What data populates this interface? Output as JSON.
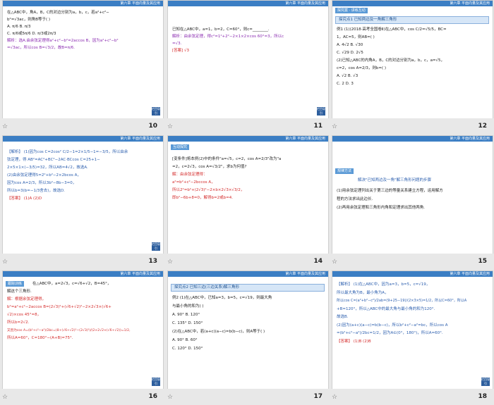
{
  "header_tag": "第六章  平面向量及其应用",
  "nav_label": "栏目导引",
  "star": "☆",
  "slides": [
    {
      "number": "10",
      "lines": [
        "在△ABC中，角A，B，C的对边分别为a，b，c，若a²+c²−",
        "b²=√3ac，则角B等于(      )",
        "A. π/6                       B. π/3",
        "C. π/6或5π/6              D. π/3或2π/3",
        "解析：选A.由余弦定理得a²+c²−b²=2accos B，因为a²+c²−b²",
        "=√3ac，所以cos B=√3/2，故B=π/6."
      ]
    },
    {
      "number": "11",
      "lines": [
        "已知在△ABC中，a=1，b=2，C=60°，则c=________.",
        "解析：由余弦定理，得c²=1²+2²−2×1×2×cos 60°=3，所以c",
        "=√3.",
        "[答案] √3"
      ]
    },
    {
      "number": "12",
      "tag": "探究案 · 讲练互动",
      "section": "探究点1  已知两边及一角解三角形",
      "lines": [
        "例1  (1)(2018·高考全国卷Ⅱ)在△ABC中，cos C/2=√5/5，BC=",
        "1，AC=5，则AB=(      )",
        "A. 4√2                      B. √30",
        "C. √29                      D. 2√5",
        "(2)已知△ABC的内角A，B，C的对边分别为a，b，c，a=√5，",
        "c=2，cos A=2/3，则b=(      )",
        "A. √2                        B. √3",
        "C. 2                          D. 3"
      ]
    },
    {
      "number": "13",
      "lines": [
        "【解析】 (1)因为cos C=2cos² C/2−1=2×1/5−1=−3/5，所以由余",
        "弦定理，得 AB²=AC²+BC²−2AC·BCcos C=25+1−",
        "2×5×1×(−3/5)=32，所以AB=4√2，故选A.",
        "(2)由余弦定理得5=2²+b²−2×2bcos A，",
        "因为cos A=2/3，所以3b²−8b−3=0，",
        "所以b=3(b=−1/3舍去)，故选D.",
        "【答案】 (1)A  (2)D"
      ]
    },
    {
      "number": "14",
      "tag": "互动探究",
      "lines": [
        "[变条件]将本例(2)中的条件\"a=√5，c=2，cos A=2/3\"改为\"a",
        "=2，c=2√3，cos A=√3/2\"，求b为何值?",
        "解：由余弦定理得：",
        "a²=b²+c²−2bccos A，",
        "所以2²=b²+(2√3)²−2×b×2√3×√3/2，",
        "即b²−6b+8=0，解得b=2或b=4."
      ]
    },
    {
      "number": "15",
      "tag": "规律方法",
      "section": "解决\"已知两边及一角\"解三角形问题的步骤",
      "lines": [
        "(1)用余弦定理列出关于第三边的等量关系建立方程，运用解方",
        "程的方法求出此边长.",
        "(2)再用余弦定理和三角形内角和定理求出其他两角."
      ]
    },
    {
      "number": "16",
      "tag": "跟踪训练",
      "lines": [
        "在△ABC中，a=2√3，c=√6+√2，B=45°，",
        "解这个三角形.",
        "解：根据余弦定理得，",
        "b²=a²+c²−2accos B=(2√3)²+(√6+√2)²−2×2√3×(√6+",
        "√2)×cos 45°=8，",
        "所以b=2√2.",
        "又因为cos A=(b²+c²−a²)/2bc=(8+(√6+√2)²−(2√3)²)/(2×2√2×(√6+√2))=1/2,",
        "所以A=60°，C=180°−(A+B)=75°."
      ]
    },
    {
      "number": "17",
      "section": "探究点2  已知三边(三边关系)解三角形",
      "lines": [
        "例2  (1)在△ABC中，已知a=3，b=5，c=√19，则最大角",
        "与最小角的和为(      )",
        "A. 90°                        B. 120°",
        "C. 135°                      D. 150°",
        "(2)在△ABC中，若(a+c)(a−c)=b(b−c)，则A等于(      )",
        "A. 90°                        B. 60°",
        "C. 120°                      D. 150°"
      ]
    },
    {
      "number": "18",
      "lines": [
        "【解析】 (1)在△ABC中，因为a=3，b=5，c=√19，",
        "所以最大角为B，最小角为A，",
        "所以cos C=(a²+b²−c²)/2ab=(9+25−19)/(2×3×5)=1/2，所以C=60°，所以A",
        "+B=120°，所以△ABC中的最大角与最小角的和为120°.",
        "故选B.",
        "(2)因为(a+c)(a−c)=b(b−c)，所以b²+c²−a²=bc，所以cos A",
        "=(b²+c²−a²)/2bc=1/2，因为A∈(0°，180°)，所以A=60°.",
        "【答案】 (1)B  (2)B"
      ]
    }
  ]
}
